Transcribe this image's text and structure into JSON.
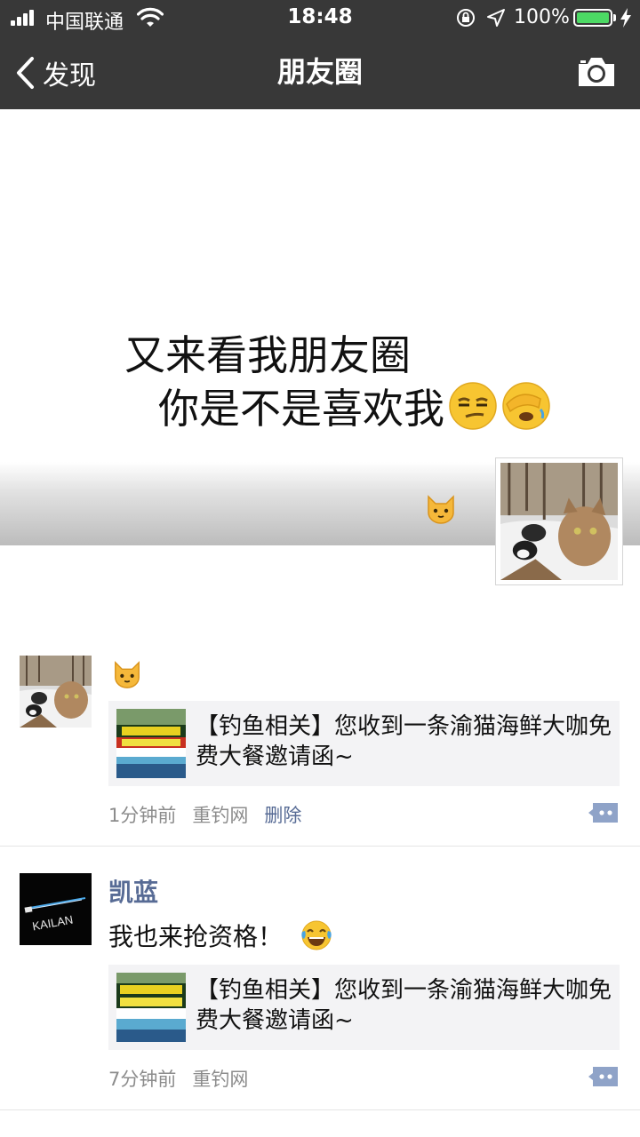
{
  "status": {
    "carrier": "中国联通",
    "time": "18:48",
    "battery": "100%",
    "battery_level": 1.0
  },
  "nav": {
    "back_label": "发现",
    "title": "朋友圈"
  },
  "cover": {
    "line1": "又来看我朋友圈",
    "line2": "你是不是喜欢我"
  },
  "posts": [
    {
      "text_emoji": "cat-face-icon",
      "link_title": "【钓鱼相关】您收到一条渝猫海鲜大咖免费大餐邀请函~",
      "time": "1分钟前",
      "source": "重钓网",
      "delete_label": "删除"
    },
    {
      "name": "凯蓝",
      "avatar_text": "KAILAN",
      "text": "我也来抢资格！",
      "link_title": "【钓鱼相关】您收到一条渝猫海鲜大咖免费大餐邀请函~",
      "time": "7分钟前",
      "source": "重钓网"
    }
  ],
  "colors": {
    "bar": "#383838",
    "link_blue": "#576b95",
    "battery_green": "#4cd964",
    "card_bg": "#f3f3f5"
  }
}
